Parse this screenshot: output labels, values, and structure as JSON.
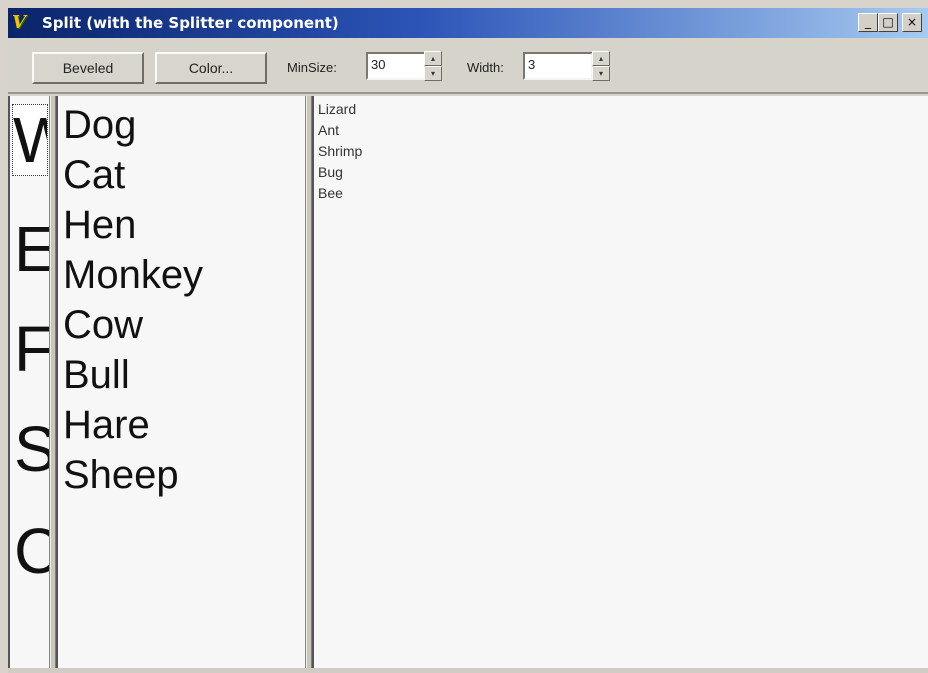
{
  "window": {
    "title": "Split (with the Splitter component)",
    "icon": "app-icon",
    "controls": {
      "minimize": "_",
      "maximize": "□",
      "close": "×"
    }
  },
  "toolbar": {
    "beveled_label": "Beveled",
    "color_label": "Color...",
    "minsize_label": "MinSize:",
    "minsize_value": "30",
    "width_label": "Width:",
    "width_value": "3",
    "spin_up": "▴",
    "spin_down": "▾"
  },
  "panels": {
    "letters": [
      "W",
      "E",
      "F",
      "S",
      "C"
    ],
    "animals": [
      "Dog",
      "Cat",
      "Hen",
      "Monkey",
      "Cow",
      "Bull",
      "Hare",
      "Sheep"
    ],
    "bugs": [
      "Lizard",
      "Ant",
      "Shrimp",
      "Bug",
      "Bee"
    ]
  },
  "colors": {
    "titlebar_start": "#0a246a",
    "titlebar_end": "#a6caf0",
    "face": "#d6d3cb",
    "panel_bg": "#f7f7f7"
  }
}
